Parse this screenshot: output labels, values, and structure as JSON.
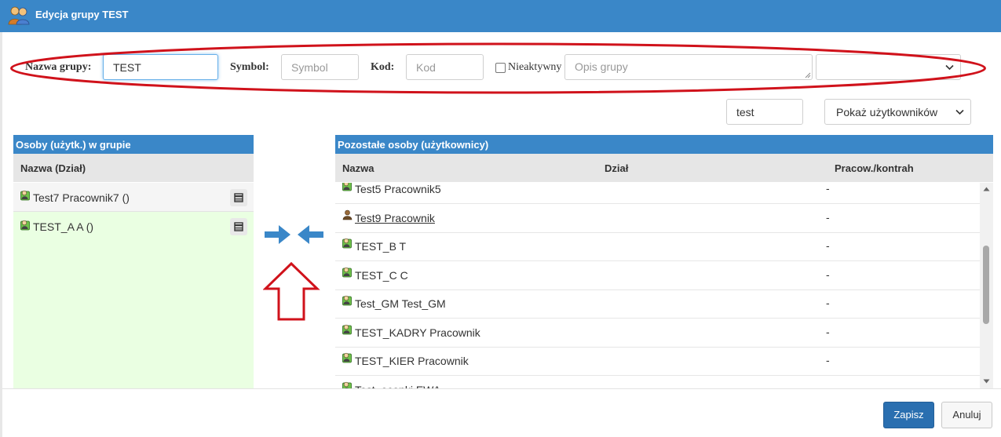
{
  "window": {
    "title": "Edycja grupy TEST",
    "icon": "users-group-icon"
  },
  "form": {
    "name_label": "Nazwa grupy:",
    "name_value": "TEST",
    "symbol_label": "Symbol:",
    "symbol_placeholder": "Symbol",
    "kod_label": "Kod:",
    "kod_placeholder": "Kod",
    "inactive_label": "Nieaktywny",
    "inactive_checked": false,
    "description_placeholder": "Opis grupy",
    "extra_select_value": ""
  },
  "filter": {
    "search_value": "test",
    "show_select_value": "Pokaż użytkowników"
  },
  "left_panel": {
    "title": "Osoby (użytk.) w grupie",
    "column_header": "Nazwa (Dział)",
    "rows": [
      {
        "name": "Test7 Pracownik7 ()"
      },
      {
        "name": "TEST_A A ()"
      }
    ]
  },
  "right_panel": {
    "title": "Pozostałe osoby (użytkownicy)",
    "columns": [
      "Nazwa",
      "Dział",
      "Pracow./kontrah"
    ],
    "rows": [
      {
        "name": "Test5 Pracownik5",
        "type": "-",
        "link": false,
        "icon": "user-green-icon"
      },
      {
        "name": "Test9 Pracownik",
        "type": "-",
        "link": true,
        "icon": "user-brown-icon"
      },
      {
        "name": "TEST_B T",
        "type": "-",
        "link": false,
        "icon": "user-green-icon"
      },
      {
        "name": "TEST_C C",
        "type": "-",
        "link": false,
        "icon": "user-green-icon"
      },
      {
        "name": "Test_GM Test_GM",
        "type": "-",
        "link": false,
        "icon": "user-green-icon"
      },
      {
        "name": "TEST_KADRY Pracownik",
        "type": "-",
        "link": false,
        "icon": "user-green-icon"
      },
      {
        "name": "TEST_KIER Pracownik",
        "type": "-",
        "link": false,
        "icon": "user-green-icon"
      },
      {
        "name": "Test_ocenki EWA",
        "type": "",
        "link": false,
        "icon": "user-green-icon"
      }
    ]
  },
  "buttons": {
    "save": "Zapisz",
    "cancel": "Anuluj"
  },
  "colors": {
    "header_blue": "#3a87c8",
    "primary_button": "#2a6fb0",
    "left_list_bg": "#eaffe2",
    "annotation_red": "#d0121b",
    "arrow_blue": "#3a87c8"
  }
}
